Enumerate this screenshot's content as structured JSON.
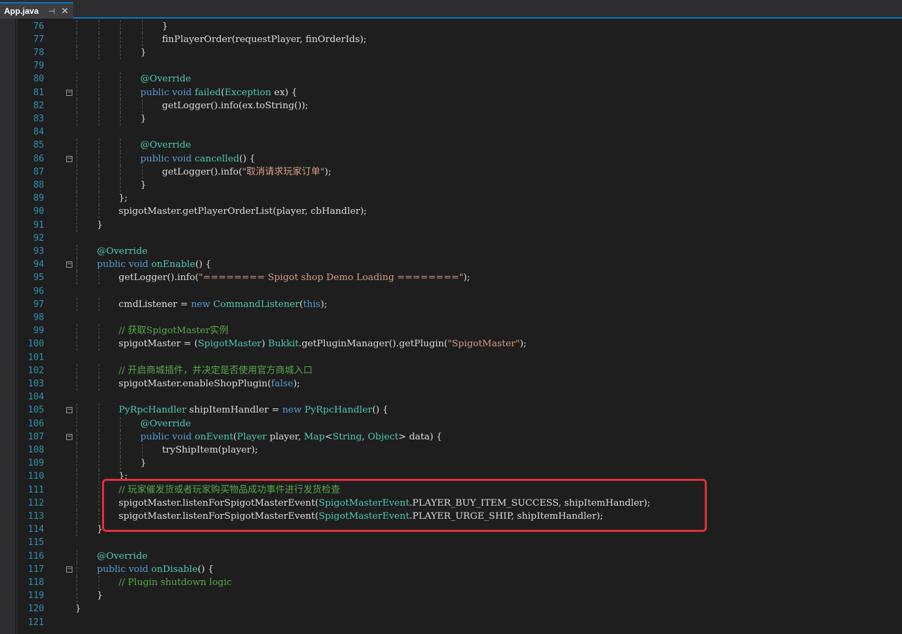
{
  "tab": {
    "title": "App.java",
    "pin_icon": "pin-icon",
    "close_icon": "close-icon"
  },
  "colors": {
    "keyword": "#569cd6",
    "type": "#4ec9b0",
    "string": "#d69d85",
    "comment": "#57a64a",
    "line_number": "#2b91af",
    "default": "#dcdcdc",
    "highlight_border": "#e0303e"
  },
  "highlight": {
    "description_lines": [
      111,
      112,
      113
    ]
  },
  "lines": [
    {
      "n": "76",
      "fold": false,
      "indent": 4,
      "tokens": [
        [
          "}",
          ""
        ]
      ]
    },
    {
      "n": "77",
      "fold": false,
      "indent": 4,
      "tokens": [
        [
          "finPlayerOrder(requestPlayer, finOrderIds);",
          ""
        ]
      ]
    },
    {
      "n": "78",
      "fold": false,
      "indent": 3,
      "tokens": [
        [
          "}",
          ""
        ]
      ]
    },
    {
      "n": "79",
      "fold": false,
      "indent": 0,
      "tokens": []
    },
    {
      "n": "80",
      "fold": false,
      "indent": 3,
      "tokens": [
        [
          "@Override",
          "an"
        ]
      ]
    },
    {
      "n": "81",
      "fold": true,
      "indent": 3,
      "tokens": [
        [
          "public void ",
          "kw"
        ],
        [
          "failed",
          "ty"
        ],
        [
          "(",
          ""
        ],
        [
          "Exception",
          "ty"
        ],
        [
          " ex) {",
          ""
        ]
      ]
    },
    {
      "n": "82",
      "fold": false,
      "indent": 4,
      "tokens": [
        [
          "getLogger().info(ex.toString());",
          ""
        ]
      ]
    },
    {
      "n": "83",
      "fold": false,
      "indent": 3,
      "tokens": [
        [
          "}",
          ""
        ]
      ]
    },
    {
      "n": "84",
      "fold": false,
      "indent": 0,
      "tokens": []
    },
    {
      "n": "85",
      "fold": false,
      "indent": 3,
      "tokens": [
        [
          "@Override",
          "an"
        ]
      ]
    },
    {
      "n": "86",
      "fold": true,
      "indent": 3,
      "tokens": [
        [
          "public void ",
          "kw"
        ],
        [
          "cancelled",
          "ty"
        ],
        [
          "() {",
          ""
        ]
      ]
    },
    {
      "n": "87",
      "fold": false,
      "indent": 4,
      "tokens": [
        [
          "getLogger().info(",
          ""
        ],
        [
          "\"取消请求玩家订单\"",
          "st"
        ],
        [
          ");",
          ""
        ]
      ]
    },
    {
      "n": "88",
      "fold": false,
      "indent": 3,
      "tokens": [
        [
          "}",
          ""
        ]
      ]
    },
    {
      "n": "89",
      "fold": false,
      "indent": 2,
      "tokens": [
        [
          "};",
          ""
        ]
      ]
    },
    {
      "n": "90",
      "fold": false,
      "indent": 2,
      "tokens": [
        [
          "spigotMaster.getPlayerOrderList(player, cbHandler);",
          ""
        ]
      ]
    },
    {
      "n": "91",
      "fold": false,
      "indent": 1,
      "tokens": [
        [
          "}",
          ""
        ]
      ]
    },
    {
      "n": "92",
      "fold": false,
      "indent": 0,
      "tokens": []
    },
    {
      "n": "93",
      "fold": false,
      "indent": 1,
      "tokens": [
        [
          "@Override",
          "an"
        ]
      ]
    },
    {
      "n": "94",
      "fold": true,
      "indent": 1,
      "tokens": [
        [
          "public void ",
          "kw"
        ],
        [
          "onEnable",
          "ty"
        ],
        [
          "() {",
          ""
        ]
      ]
    },
    {
      "n": "95",
      "fold": false,
      "indent": 2,
      "tokens": [
        [
          "getLogger().info(",
          ""
        ],
        [
          "\"======== Spigot shop Demo Loading ========\"",
          "st"
        ],
        [
          ");",
          ""
        ]
      ]
    },
    {
      "n": "96",
      "fold": false,
      "indent": 0,
      "tokens": []
    },
    {
      "n": "97",
      "fold": false,
      "indent": 2,
      "tokens": [
        [
          "cmdListener = ",
          ""
        ],
        [
          "new ",
          "kw"
        ],
        [
          "CommandListener",
          "ty"
        ],
        [
          "(",
          ""
        ],
        [
          "this",
          "kw"
        ],
        [
          ");",
          ""
        ]
      ]
    },
    {
      "n": "98",
      "fold": false,
      "indent": 0,
      "tokens": []
    },
    {
      "n": "99",
      "fold": false,
      "indent": 2,
      "tokens": [
        [
          "// 获取SpigotMaster实例",
          "cm"
        ]
      ]
    },
    {
      "n": "100",
      "fold": false,
      "indent": 2,
      "tokens": [
        [
          "spigotMaster = (",
          ""
        ],
        [
          "SpigotMaster",
          "ty"
        ],
        [
          ") ",
          ""
        ],
        [
          "Bukkit",
          "ty"
        ],
        [
          ".getPluginManager().getPlugin(",
          ""
        ],
        [
          "\"SpigotMaster\"",
          "st"
        ],
        [
          ");",
          ""
        ]
      ]
    },
    {
      "n": "101",
      "fold": false,
      "indent": 0,
      "tokens": []
    },
    {
      "n": "102",
      "fold": false,
      "indent": 2,
      "tokens": [
        [
          "// 开启商城插件，并决定是否使用官方商城入口",
          "cm"
        ]
      ]
    },
    {
      "n": "103",
      "fold": false,
      "indent": 2,
      "tokens": [
        [
          "spigotMaster.enableShopPlugin(",
          ""
        ],
        [
          "false",
          "kw"
        ],
        [
          ");",
          ""
        ]
      ]
    },
    {
      "n": "104",
      "fold": false,
      "indent": 0,
      "tokens": []
    },
    {
      "n": "105",
      "fold": true,
      "indent": 2,
      "tokens": [
        [
          "PyRpcHandler",
          "ty"
        ],
        [
          " shipItemHandler = ",
          ""
        ],
        [
          "new ",
          "kw"
        ],
        [
          "PyRpcHandler",
          "ty"
        ],
        [
          "() {",
          ""
        ]
      ]
    },
    {
      "n": "106",
      "fold": false,
      "indent": 3,
      "tokens": [
        [
          "@Override",
          "an"
        ]
      ]
    },
    {
      "n": "107",
      "fold": true,
      "indent": 3,
      "tokens": [
        [
          "public void ",
          "kw"
        ],
        [
          "onEvent",
          "ty"
        ],
        [
          "(",
          ""
        ],
        [
          "Player",
          "ty"
        ],
        [
          " player, ",
          ""
        ],
        [
          "Map",
          "ty"
        ],
        [
          "<",
          ""
        ],
        [
          "String",
          "ty"
        ],
        [
          ", ",
          ""
        ],
        [
          "Object",
          "ty"
        ],
        [
          "> data) {",
          ""
        ]
      ]
    },
    {
      "n": "108",
      "fold": false,
      "indent": 4,
      "tokens": [
        [
          "tryShipItem(player);",
          ""
        ]
      ]
    },
    {
      "n": "109",
      "fold": false,
      "indent": 3,
      "tokens": [
        [
          "}",
          ""
        ]
      ]
    },
    {
      "n": "110",
      "fold": false,
      "indent": 2,
      "tokens": [
        [
          "};",
          ""
        ]
      ]
    },
    {
      "n": "111",
      "fold": false,
      "indent": 2,
      "tokens": [
        [
          "// 玩家催发货或者玩家购买物品成功事件进行发货检查",
          "cm"
        ]
      ]
    },
    {
      "n": "112",
      "fold": false,
      "indent": 2,
      "tokens": [
        [
          "spigotMaster.listenForSpigotMasterEvent(",
          ""
        ],
        [
          "SpigotMasterEvent",
          "ty"
        ],
        [
          ".PLAYER_BUY_ITEM_SUCCESS, shipItemHandler);",
          ""
        ]
      ]
    },
    {
      "n": "113",
      "fold": false,
      "indent": 2,
      "tokens": [
        [
          "spigotMaster.listenForSpigotMasterEvent(",
          ""
        ],
        [
          "SpigotMasterEvent",
          "ty"
        ],
        [
          ".PLAYER_URGE_SHIP, shipItemHandler);",
          ""
        ]
      ]
    },
    {
      "n": "114",
      "fold": false,
      "indent": 1,
      "tokens": [
        [
          "}",
          ""
        ]
      ]
    },
    {
      "n": "115",
      "fold": false,
      "indent": 0,
      "tokens": []
    },
    {
      "n": "116",
      "fold": false,
      "indent": 1,
      "tokens": [
        [
          "@Override",
          "an"
        ]
      ]
    },
    {
      "n": "117",
      "fold": true,
      "indent": 1,
      "tokens": [
        [
          "public void ",
          "kw"
        ],
        [
          "onDisable",
          "ty"
        ],
        [
          "() {",
          ""
        ]
      ]
    },
    {
      "n": "118",
      "fold": false,
      "indent": 2,
      "tokens": [
        [
          "// Plugin shutdown logic",
          "cm"
        ]
      ]
    },
    {
      "n": "119",
      "fold": false,
      "indent": 1,
      "tokens": [
        [
          "}",
          ""
        ]
      ]
    },
    {
      "n": "120",
      "fold": false,
      "indent": 0,
      "tokens": [
        [
          "}",
          ""
        ]
      ]
    },
    {
      "n": "121",
      "fold": false,
      "indent": 0,
      "tokens": []
    }
  ]
}
